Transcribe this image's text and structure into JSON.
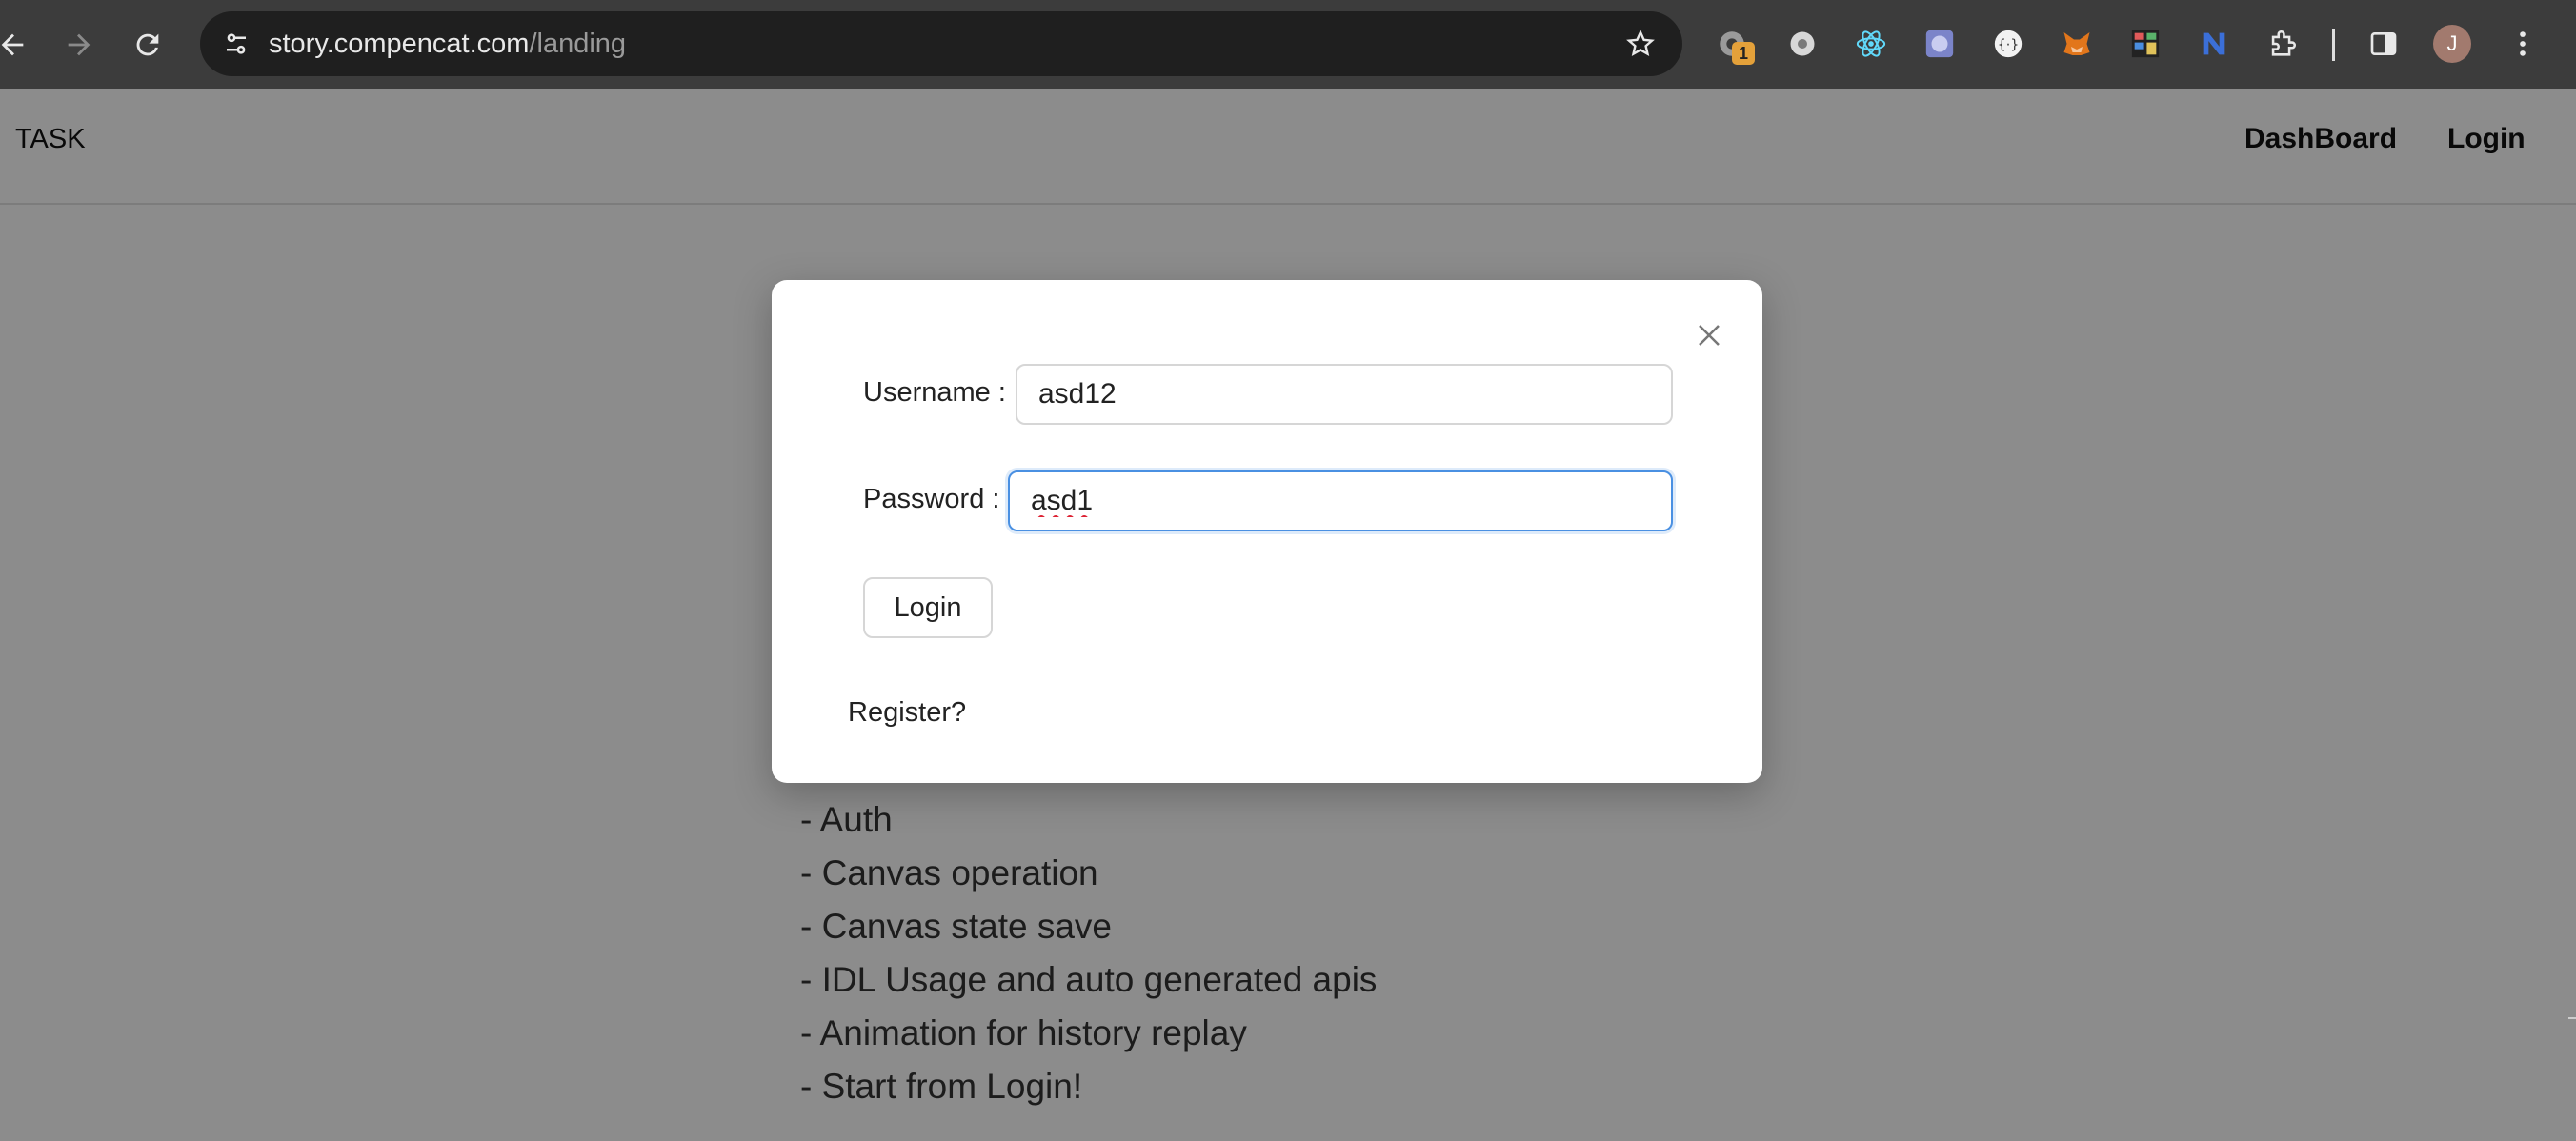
{
  "browser": {
    "url_host": "story.compencat.com",
    "url_path": "/landing",
    "extension_badge": "1",
    "profile_initial": "J",
    "icons": [
      "back-arrow-icon",
      "forward-arrow-icon",
      "reload-icon",
      "site-info-icon",
      "bookmark-star-icon",
      "extensions-puzzle-icon",
      "side-panel-icon",
      "more-vert-icon"
    ]
  },
  "header": {
    "brand": "TASK",
    "nav": [
      "DashBoard",
      "Login"
    ]
  },
  "content": {
    "lines": [
      "- Auth",
      "- Canvas operation",
      "- Canvas state save",
      "- IDL Usage and auto generated apis",
      "- Animation for history replay",
      "- Start from Login!"
    ]
  },
  "modal": {
    "username_label": "Username",
    "username_value": "asd12",
    "password_label": "Password",
    "password_value": "asd1",
    "login_label": "Login",
    "register_label": "Register?"
  },
  "colors": {
    "chrome_bg": "#3c3c3c",
    "omnibox_bg": "#1f1f1f",
    "focus_blue": "#4a90e2",
    "overlay": "rgba(0,0,0,0.45)"
  }
}
